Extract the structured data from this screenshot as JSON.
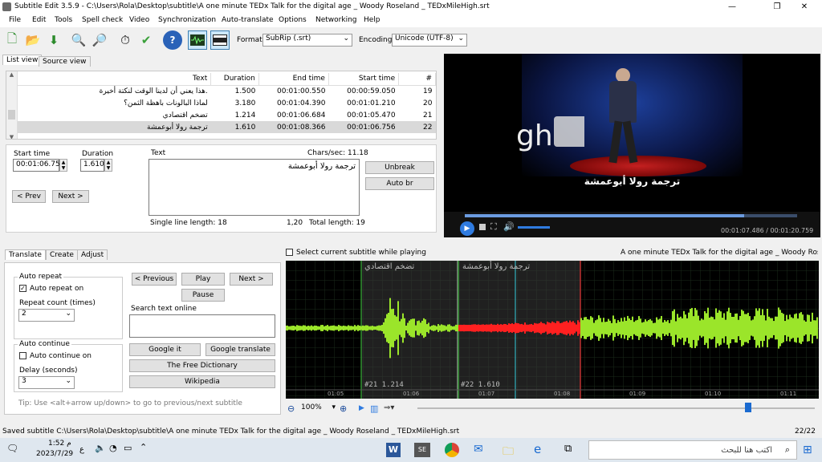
{
  "window": {
    "title": "Subtitle Edit 3.5.9 - C:\\Users\\Rola\\Desktop\\subtitle\\A one minute TEDx Talk for the digital age _ Woody Roseland _ TEDxMileHigh.srt",
    "minimize": "—",
    "maximize": "❐",
    "close": "✕"
  },
  "menu": [
    "File",
    "Edit",
    "Tools",
    "Spell check",
    "Video",
    "Synchronization",
    "Auto-translate",
    "Options",
    "Networking",
    "Help"
  ],
  "toolbar": {
    "format_label": "Format",
    "format_value": "SubRip (.srt)",
    "encoding_label": "Encoding",
    "encoding_value": "Unicode (UTF-8)"
  },
  "view_tabs": [
    "List view",
    "Source view"
  ],
  "subtitle_table": {
    "columns": [
      "#",
      "Start time",
      "End time",
      "Duration",
      "Text"
    ],
    "rows": [
      {
        "num": "19",
        "start": "00:00:59.050",
        "end": "00:01:00.550",
        "duration": "1.500",
        "text": "هذا يعني أن لدينا الوقت لنكتة أخيرة."
      },
      {
        "num": "20",
        "start": "00:01:01.210",
        "end": "00:01:04.390",
        "duration": "3.180",
        "text": "لماذا البالونات باهظة الثمن؟"
      },
      {
        "num": "21",
        "start": "00:01:05.470",
        "end": "00:01:06.684",
        "duration": "1.214",
        "text": "تضخم اقتصادي"
      },
      {
        "num": "22",
        "start": "00:01:06.756",
        "end": "00:01:08.366",
        "duration": "1.610",
        "text": "ترجمة رولا أبوعمشة"
      }
    ]
  },
  "editor": {
    "start_label": "Start time",
    "start_value": "00:01:06.756",
    "duration_label": "Duration",
    "duration_value": "1.610",
    "text_label": "Text",
    "chars_sec": "Chars/sec: 11.18",
    "text_value": "ترجمة رولا أبوعمشة",
    "prev": "< Prev",
    "next": "Next >",
    "unbreak": "Unbreak",
    "auto_br": "Auto br",
    "single_line": "Single line length: 18",
    "pos": "1,20",
    "total": "Total length: 19"
  },
  "video": {
    "subtitle": "ترجمة رولا أبوعمشة",
    "time": "00:01:07.486 / 00:01:20.759",
    "progress": 0.84,
    "stage_text": "gh"
  },
  "bottom_tabs": [
    "Translate",
    "Create",
    "Adjust"
  ],
  "translate": {
    "auto_repeat": "Auto repeat",
    "auto_repeat_on": "Auto repeat on",
    "repeat_count": "Repeat count (times)",
    "repeat_value": "2",
    "auto_continue": "Auto continue",
    "auto_continue_on": "Auto continue on",
    "delay": "Delay (seconds)",
    "delay_value": "3",
    "previous": "< Previous",
    "play": "Play",
    "next": "Next >",
    "pause": "Pause",
    "search_label": "Search text online",
    "google_it": "Google it",
    "google_translate": "Google translate",
    "free_dictionary": "The Free Dictionary",
    "wikipedia": "Wikipedia",
    "tip": "Tip: Use <alt+arrow up/down> to go to previous/next subtitle"
  },
  "waveform": {
    "select_current": "Select current subtitle while playing",
    "title": "A one minute TEDx Talk for the digital age _ Woody Roseland _",
    "seg21_text": "تضخم اقتصادي",
    "seg21_label": "#21  1.214",
    "seg22_text": "ترجمة رولا أبوعمشة",
    "seg22_label": "#22  1.610",
    "ticks": [
      "01:05",
      "01:06",
      "01:07",
      "01:08",
      "01:09",
      "01:10",
      "01:11"
    ],
    "zoom": "100%"
  },
  "status": {
    "left": "Saved subtitle C:\\Users\\Rola\\Desktop\\subtitle\\A one minute TEDx Talk for the digital age _ Woody Roseland _ TEDxMileHigh.srt",
    "right": "22/22"
  },
  "taskbar": {
    "time": "1:52 م",
    "date": "2023/7/29",
    "search": "اكتب هنا للبحث",
    "lang": "ع"
  }
}
